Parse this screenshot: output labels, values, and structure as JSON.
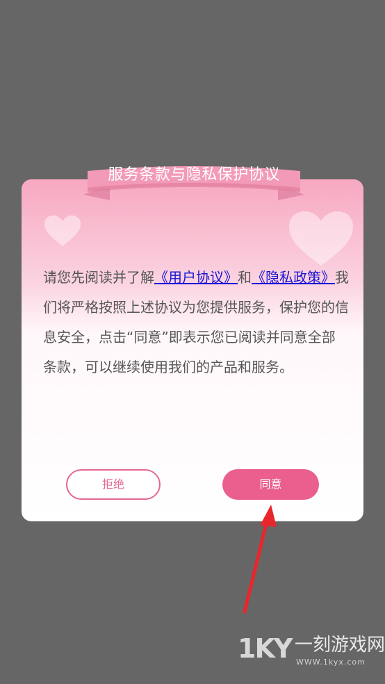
{
  "dialog": {
    "title": "服务条款与隐私保护协议",
    "text_intro": "请您先阅读并了解",
    "link_user_agreement": "《用户协议》",
    "text_and": "和",
    "link_privacy_policy": "《隐私政策》",
    "text_body": "我们将严格按照上述协议为您提供服务，保护您的信息安全，点击“同意”即表示您已阅读并同意全部条款，可以继续使用我们的产品和服务。",
    "reject_label": "拒绝",
    "agree_label": "同意"
  },
  "watermark": {
    "logo": "1KY",
    "name": "一刻游戏网",
    "url": "WWW.1kyx.com"
  },
  "colors": {
    "backdrop": "#666666",
    "accent": "#ea5f8d",
    "link": "#1a12d6"
  }
}
